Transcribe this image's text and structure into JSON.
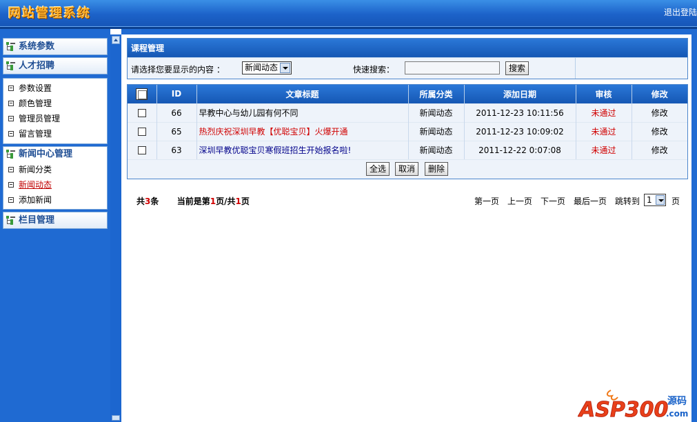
{
  "header": {
    "logo": "网站管理系统",
    "logout": "退出登陆"
  },
  "sidebar": {
    "titles": [
      "系统参数",
      "人才招聘",
      "新闻中心管理",
      "栏目管理"
    ],
    "group1": [
      "参数设置",
      "颜色管理",
      "管理员管理",
      "留言管理"
    ],
    "news_items": [
      "新闻分类",
      "新闻动态",
      "添加新闻"
    ]
  },
  "panel": {
    "title": "课程管理",
    "show_label": "请选择您要显示的内容 ：",
    "category_select": "新闻动态",
    "search_label": "快速搜索：",
    "search_value": "",
    "search_button": "搜索"
  },
  "table": {
    "headers": [
      "ID",
      "文章标题",
      "所属分类",
      "添加日期",
      "审核",
      "修改"
    ],
    "rows": [
      {
        "id": "66",
        "title": "早教中心与幼儿园有何不同",
        "category": "新闻动态",
        "date": "2011-12-23 10:11:56",
        "status": "未通过",
        "edit": "修改",
        "title_color": "#000000"
      },
      {
        "id": "65",
        "title": "热烈庆祝深圳早教【优聪宝贝】火爆开通",
        "category": "新闻动态",
        "date": "2011-12-23 10:09:02",
        "status": "未通过",
        "edit": "修改",
        "title_color": "#d00000"
      },
      {
        "id": "63",
        "title": "深圳早教优聪宝贝寒假班招生开始报名啦!",
        "category": "新闻动态",
        "date": "2011-12-22 0:07:08",
        "status": "未通过",
        "edit": "修改",
        "title_color": "#00008a"
      }
    ],
    "buttons": [
      "全选",
      "取消",
      "删除"
    ]
  },
  "pagination": {
    "total_prefix": "共",
    "total": "3",
    "total_suffix": "条",
    "current_prefix": "当前是第",
    "current": "1",
    "mid": "页/共",
    "pages": "1",
    "pages_suffix": "页",
    "first": "第一页",
    "prev": "上一页",
    "next": "下一页",
    "last": "最后一页",
    "jump_label": "跳转到",
    "jump_value": "1",
    "page_unit": "页"
  },
  "watermark": {
    "text": "ASP300",
    "sub": "源码",
    "domain": ".com"
  }
}
